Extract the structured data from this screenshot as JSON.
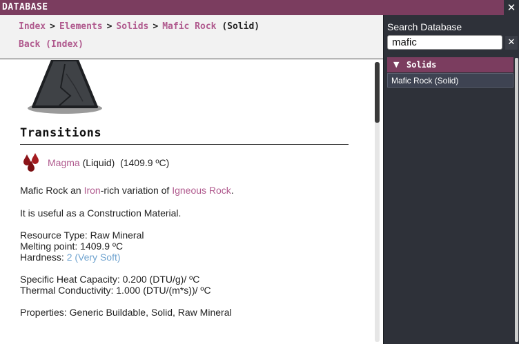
{
  "window": {
    "title": "DATABASE",
    "close_glyph": "✕"
  },
  "nav": {
    "breadcrumbs": [
      {
        "label": "Index",
        "link": true
      },
      {
        "label": "Elements",
        "link": true
      },
      {
        "label": "Solids",
        "link": true
      },
      {
        "label": "Mafic Rock",
        "link": true
      },
      {
        "label": "(Solid)",
        "link": false
      }
    ],
    "separator": ">",
    "back_label": "Back (Index)"
  },
  "entry": {
    "image_icon": "mafic-rock-image",
    "transitions_title": "Transitions",
    "transition": {
      "icon": "liquid-drops-icon",
      "target": "Magma",
      "state": "(Liquid)",
      "temperature": "(1409.9 ºC)"
    },
    "description": {
      "name": "Mafic Rock an ",
      "link1": "Iron",
      "middle": "-rich variation of ",
      "link2": "Igneous Rock",
      "end": "."
    },
    "usage": "It is useful as a Construction Material.",
    "resource_type": "Resource Type: Raw Mineral",
    "melting_point": "Melting point: 1409.9 ºC",
    "hardness_label": "Hardness: ",
    "hardness_value": "2 (Very Soft)",
    "heat_capacity": "Specific Heat Capacity: 0.200 (DTU/g)/ ºC",
    "thermal_conductivity": "Thermal Conductivity: 1.000 (DTU/(m*s))/ ºC",
    "properties": "Properties: Generic Buildable, Solid, Raw Mineral"
  },
  "search": {
    "label": "Search Database",
    "value": "mafic",
    "clear_glyph": "✕",
    "category": {
      "arrow": "▼",
      "label": "Solids"
    },
    "results": [
      "Mafic Rock (Solid)"
    ]
  },
  "colors": {
    "accent": "#7b3d5f",
    "link": "#b05a8e",
    "value_link": "#6fa3cf",
    "panel_dark": "#2e3139"
  }
}
